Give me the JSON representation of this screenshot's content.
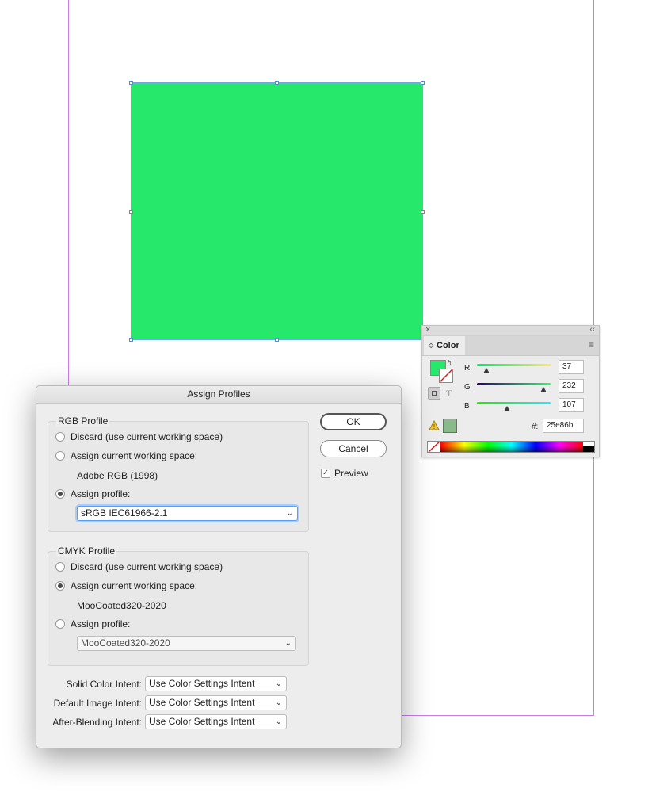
{
  "document": {
    "frame_fill": "#26e86b",
    "guide_color": "#c97ef0"
  },
  "color_panel": {
    "title": "Color",
    "close_glyph": "×",
    "collapse_glyph": "‹‹",
    "menu_glyph": "≡",
    "text_glyph": "T",
    "r_label": "R",
    "g_label": "G",
    "b_label": "B",
    "r_value": "37",
    "g_value": "232",
    "b_value": "107",
    "hex_label": "#:",
    "hex_value": "25e86b",
    "fill_color": "#26e86b",
    "out_of_gamut_color": "#8ab98a"
  },
  "dialog": {
    "title": "Assign Profiles",
    "rgb": {
      "title": "RGB Profile",
      "discard_label": "Discard (use current working space)",
      "assign_current_label": "Assign current working space:",
      "working_space": "Adobe RGB (1998)",
      "assign_profile_label": "Assign profile:",
      "profile_value": "sRGB IEC61966-2.1",
      "selected": "assign_profile"
    },
    "cmyk": {
      "title": "CMYK Profile",
      "discard_label": "Discard (use current working space)",
      "assign_current_label": "Assign current working space:",
      "working_space": "MooCoated320-2020",
      "assign_profile_label": "Assign profile:",
      "profile_value": "MooCoated320-2020",
      "selected": "assign_current"
    },
    "ok_label": "OK",
    "cancel_label": "Cancel",
    "preview_label": "Preview",
    "preview_checked": true,
    "intents": [
      {
        "label": "Solid Color Intent:",
        "value": "Use Color Settings Intent"
      },
      {
        "label": "Default Image Intent:",
        "value": "Use Color Settings Intent"
      },
      {
        "label": "After-Blending Intent:",
        "value": "Use Color Settings Intent"
      }
    ]
  }
}
